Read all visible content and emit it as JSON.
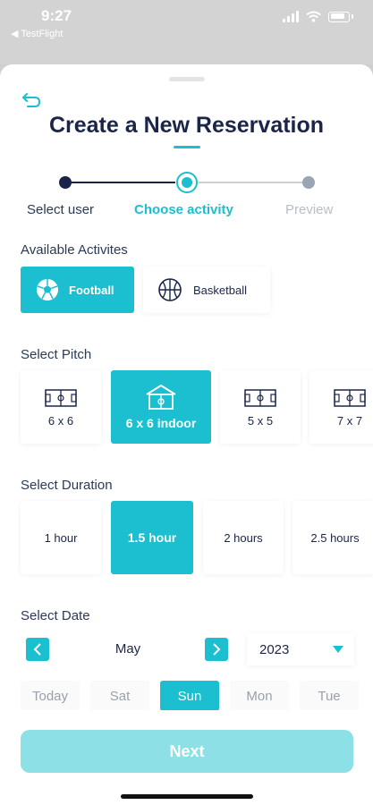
{
  "status_bar": {
    "time": "9:27",
    "back_app": "◀ TestFlight"
  },
  "header": {
    "title": "Create a New Reservation"
  },
  "stepper": {
    "steps": [
      {
        "label": "Select user",
        "state": "done"
      },
      {
        "label": "Choose activity",
        "state": "active"
      },
      {
        "label": "Preview",
        "state": "pending"
      }
    ]
  },
  "activities": {
    "label": "Available Activites",
    "items": [
      {
        "label": "Football",
        "icon": "football-icon",
        "selected": true
      },
      {
        "label": "Basketball",
        "icon": "basketball-icon",
        "selected": false
      }
    ]
  },
  "pitch": {
    "label": "Select Pitch",
    "items": [
      {
        "label": "6 x 6",
        "icon": "pitch-icon",
        "selected": false
      },
      {
        "label": "6 x 6 indoor",
        "icon": "indoor-pitch-icon",
        "selected": true
      },
      {
        "label": "5 x 5",
        "icon": "pitch-icon",
        "selected": false
      },
      {
        "label": "7 x 7",
        "icon": "pitch-icon",
        "selected": false
      }
    ]
  },
  "duration": {
    "label": "Select Duration",
    "items": [
      {
        "label": "1 hour",
        "selected": false
      },
      {
        "label": "1.5 hour",
        "selected": true
      },
      {
        "label": "2 hours",
        "selected": false
      },
      {
        "label": "2.5 hours",
        "selected": false
      }
    ]
  },
  "date": {
    "label": "Select Date",
    "month": "May",
    "year": "2023",
    "days": [
      {
        "label": "Today",
        "selected": false
      },
      {
        "label": "Sat",
        "selected": false
      },
      {
        "label": "Sun",
        "selected": true
      },
      {
        "label": "Mon",
        "selected": false
      },
      {
        "label": "Tue",
        "selected": false
      }
    ]
  },
  "footer": {
    "next_label": "Next"
  },
  "colors": {
    "accent": "#1bbfcf",
    "title": "#1a2549",
    "button_disabled": "#8ee0e7"
  }
}
